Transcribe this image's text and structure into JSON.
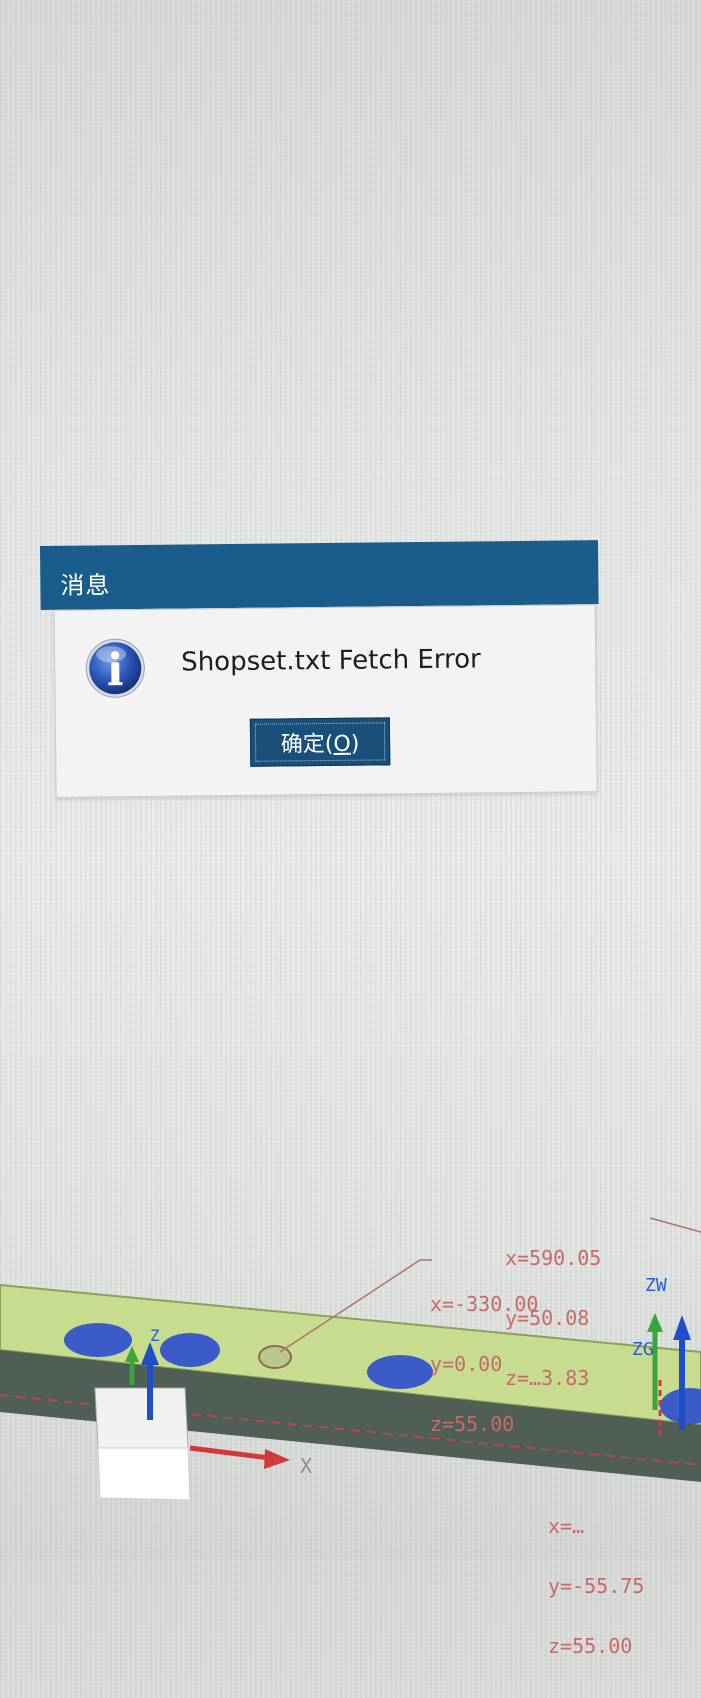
{
  "dialog": {
    "title": "消息",
    "message": "Shopset.txt Fetch Error",
    "icon": "information-icon",
    "ok_button": {
      "label_main": "确定(",
      "label_key": "O",
      "label_end": ")"
    }
  },
  "viewport": {
    "markers": [
      {
        "x": "x=590.05",
        "y": "y=50.08",
        "z": "z=…3.83"
      },
      {
        "x": "x=-330.00",
        "y": "y=0.00",
        "z": "z=55.00"
      },
      {
        "x": "x=…",
        "y": "y=-55.75",
        "z": "z=55.00"
      }
    ],
    "axis_label": "X",
    "gizmo_labels": [
      "ZW",
      "ZG",
      "Z"
    ]
  },
  "colors": {
    "titlebar": "#1a5c8c",
    "button": "#1a4f7a",
    "part_green": "#c7dc8e",
    "part_dark": "#4f5f55",
    "blue_regions": "#3b5cc8",
    "annotation_red": "#c66a6a"
  }
}
